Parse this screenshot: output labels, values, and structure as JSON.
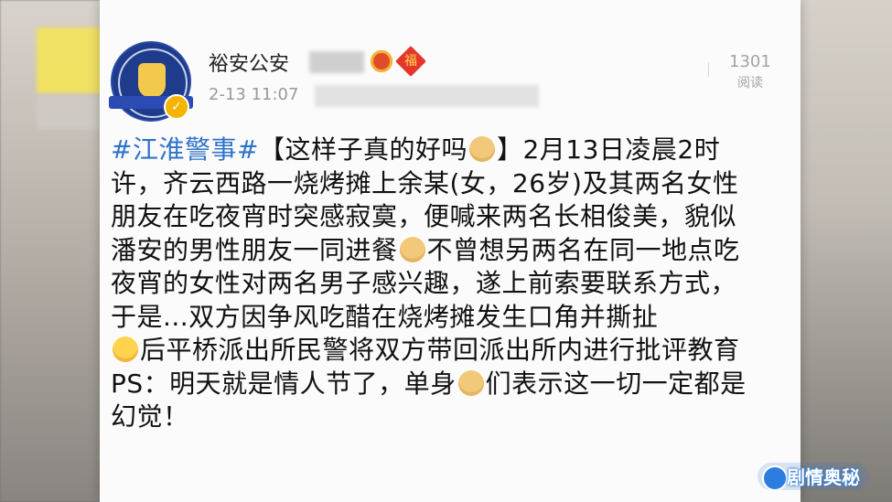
{
  "post": {
    "account_name": "裕安公安",
    "timestamp": "2-13 11:07",
    "read_count": "1301",
    "read_label": "阅读",
    "hashtag": "#江淮警事#",
    "text_part1": "【这样子真的好吗",
    "text_part2": "】2月13日凌晨2时许，齐云西路一烧烤摊上余某(女，26岁)及其两名女性朋友在吃夜宵时突感寂寞，便喊来两名长相俊美，貌似潘安的男性朋友一同进餐",
    "text_part3": "不曾想另两名在同一地点吃夜宵的女性对两名男子感兴趣，遂上前索要联系方式，于是...双方因争风吃醋在烧烤摊发生口角并撕扯",
    "text_part4": "后平桥派出所民警将双方带回派出所内进行批评教育PS：明天就是情人节了，单身",
    "text_part5": "们表示这一切一定都是幻觉！"
  },
  "badges": {
    "lantern": "lantern-icon",
    "fu": "福"
  },
  "watermark": {
    "text": "剧情奥秘"
  }
}
